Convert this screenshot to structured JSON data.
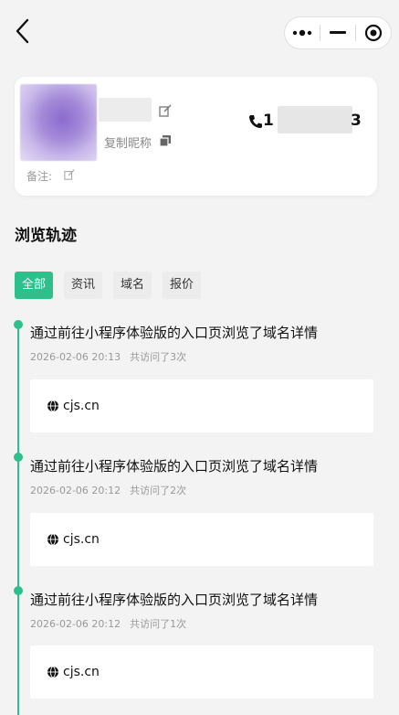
{
  "header": {
    "back_icon": "chevron-left-icon",
    "capsule_icons": [
      "more-dots-icon",
      "minimize-icon",
      "close-target-icon"
    ]
  },
  "profile": {
    "copy_nickname": "复制昵称",
    "note_label": "备注:",
    "phone_prefix": "1",
    "phone_suffix": "3"
  },
  "section": {
    "title": "浏览轨迹"
  },
  "tabs": [
    {
      "label": "全部",
      "active": true
    },
    {
      "label": "资讯",
      "active": false
    },
    {
      "label": "域名",
      "active": false
    },
    {
      "label": "报价",
      "active": false
    }
  ],
  "events": [
    {
      "title": "通过前往小程序体验版的入口页浏览了域名详情",
      "time": "2026-02-06 20:13",
      "visits": "共访问了3次",
      "domain": "cjs.cn"
    },
    {
      "title": "通过前往小程序体验版的入口页浏览了域名详情",
      "time": "2026-02-06 20:12",
      "visits": "共访问了2次",
      "domain": "cjs.cn"
    },
    {
      "title": "通过前往小程序体验版的入口页浏览了域名详情",
      "time": "2026-02-06 20:12",
      "visits": "共访问了1次",
      "domain": "cjs.cn"
    }
  ],
  "colors": {
    "accent": "#2dbf8c",
    "background": "#f3f3f3"
  }
}
